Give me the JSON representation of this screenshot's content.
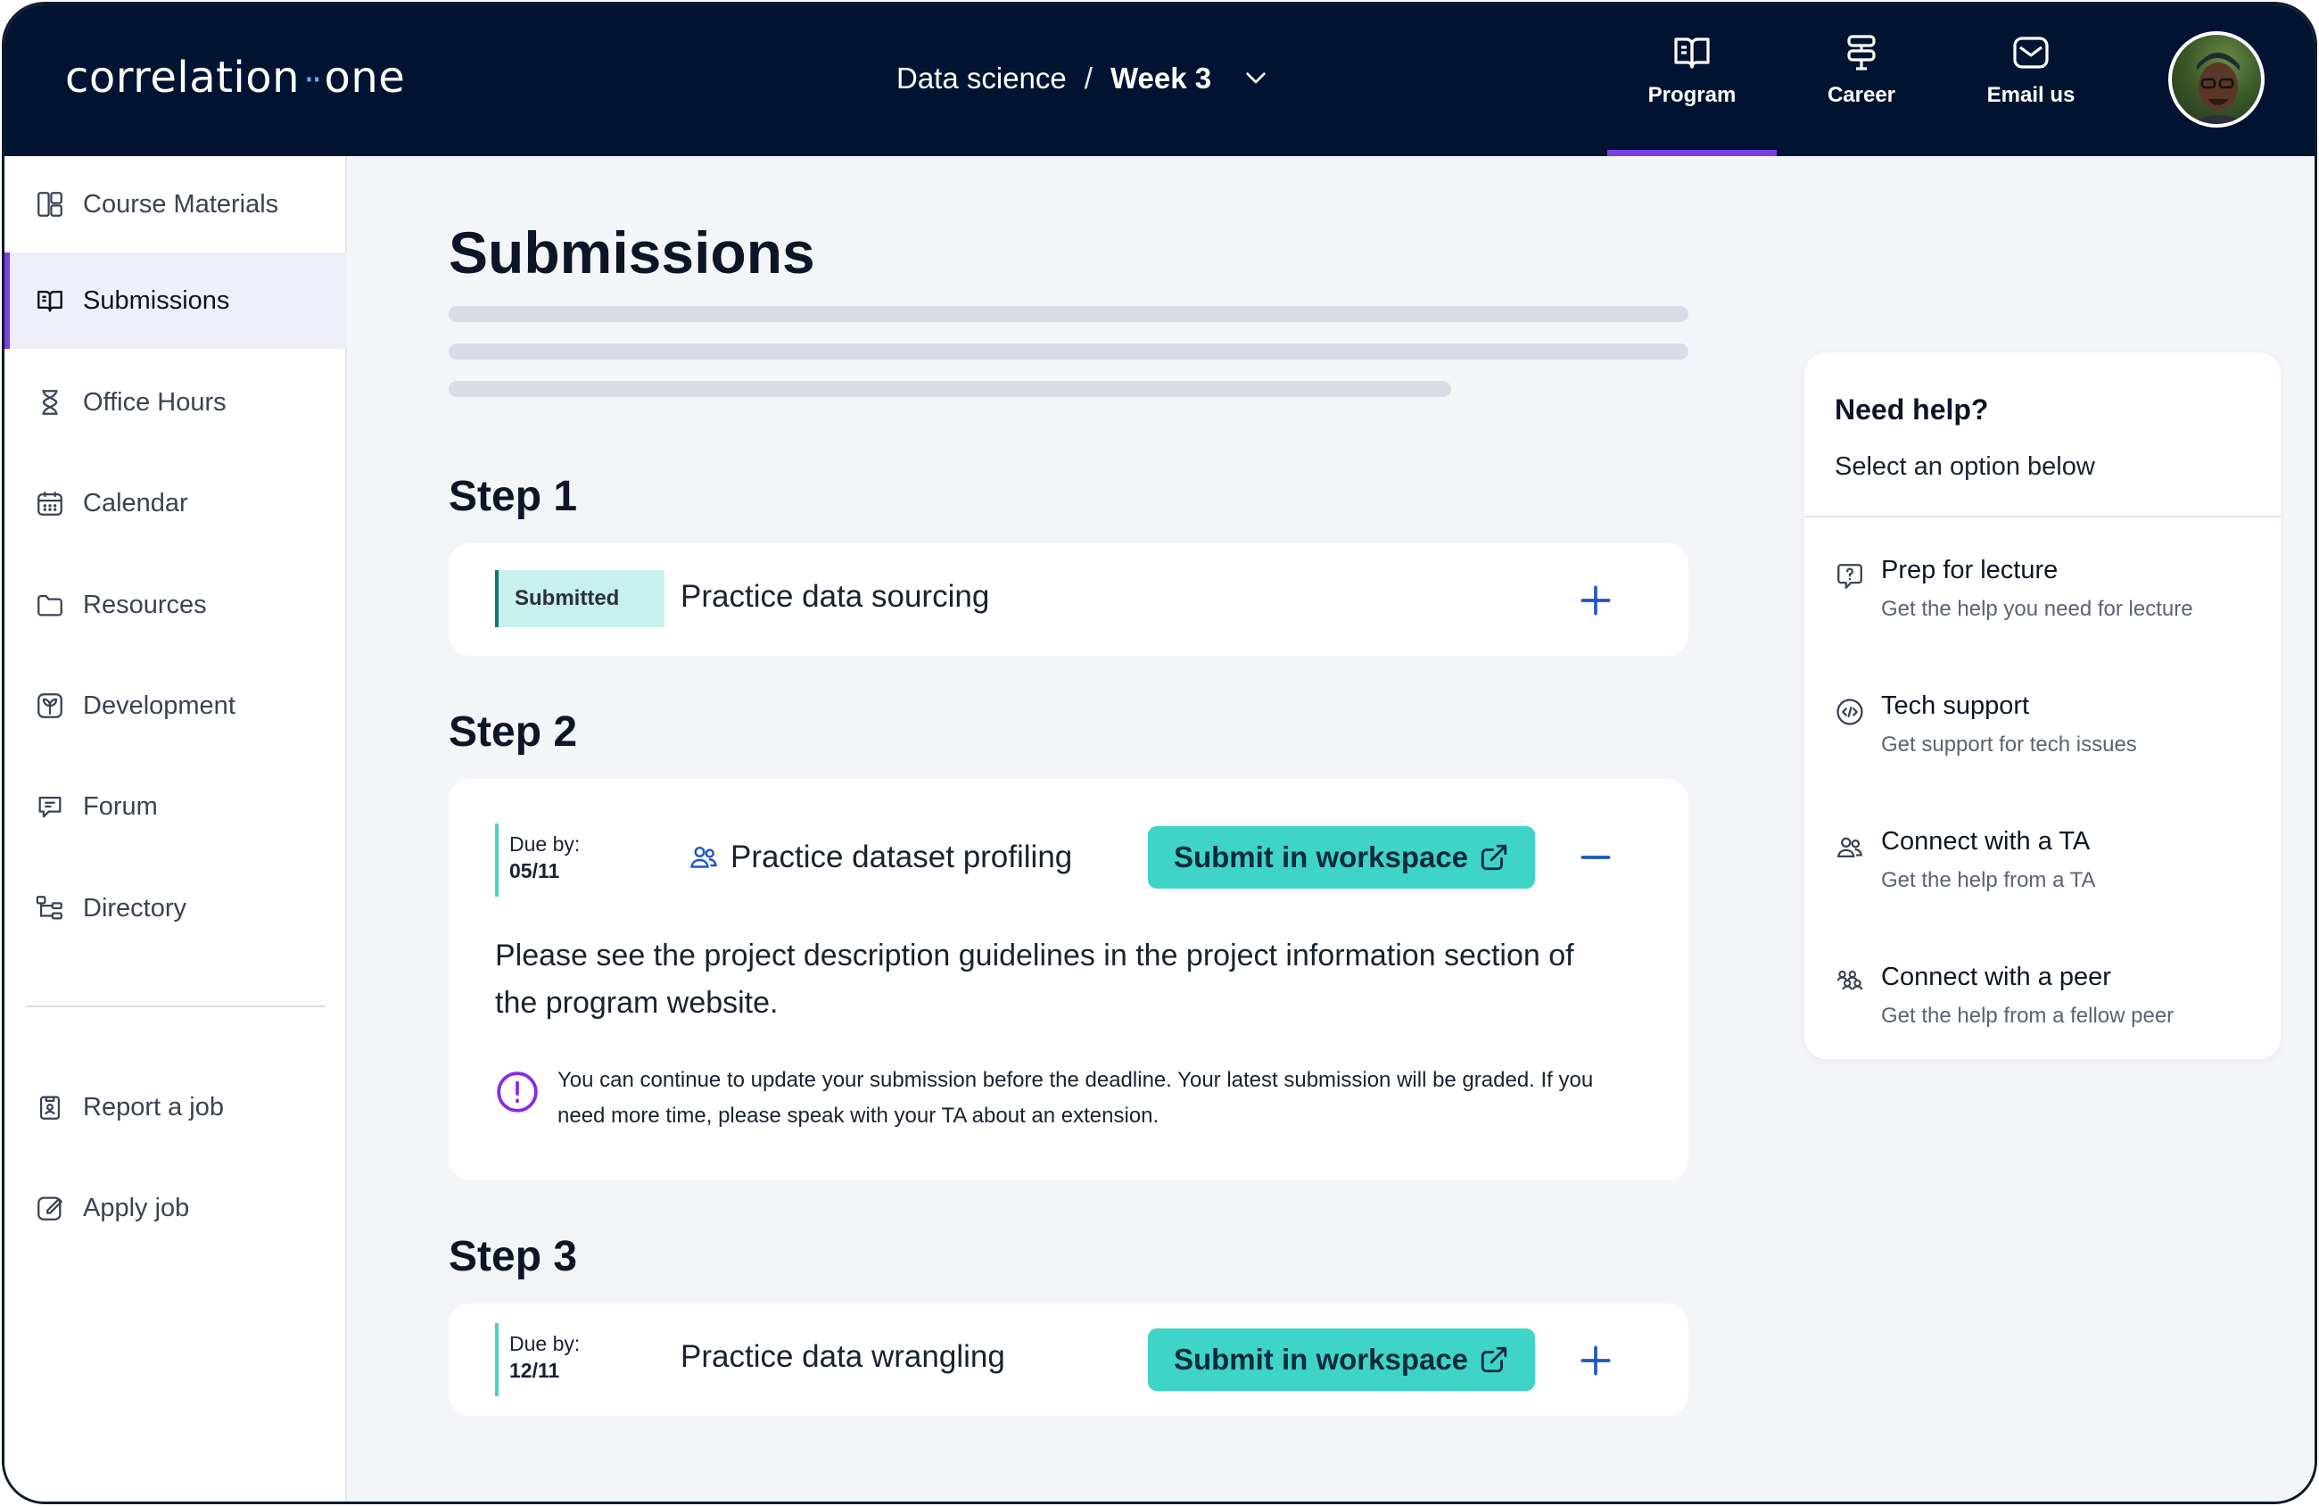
{
  "brand": {
    "logo_left": "correlation",
    "logo_dots": "··",
    "logo_right": "one"
  },
  "header": {
    "breadcrumb_program": "Data science",
    "breadcrumb_sep": "/",
    "breadcrumb_week": "Week 3",
    "nav": [
      {
        "label": "Program",
        "icon": "book-icon",
        "active": true
      },
      {
        "label": "Career",
        "icon": "signpost-icon",
        "active": false
      },
      {
        "label": "Email us",
        "icon": "mail-icon",
        "active": false
      }
    ]
  },
  "sidebar": {
    "items": [
      {
        "label": "Course Materials",
        "icon": "layout-icon"
      },
      {
        "label": "Submissions",
        "icon": "book-open-icon",
        "active": true
      },
      {
        "label": "Office Hours",
        "icon": "hourglass-icon"
      },
      {
        "label": "Calendar",
        "icon": "calendar-icon"
      },
      {
        "label": "Resources",
        "icon": "folder-icon"
      },
      {
        "label": "Development",
        "icon": "growth-icon"
      },
      {
        "label": "Forum",
        "icon": "chat-icon"
      },
      {
        "label": "Directory",
        "icon": "hierarchy-icon"
      }
    ],
    "bottom_items": [
      {
        "label": "Report a job",
        "icon": "clipboard-icon"
      },
      {
        "label": "Apply job",
        "icon": "edit-icon"
      }
    ]
  },
  "main": {
    "title": "Submissions",
    "steps": [
      {
        "heading": "Step 1",
        "status": "Submitted",
        "title": "Practice data sourcing",
        "toggle": "plus"
      },
      {
        "heading": "Step 2",
        "due_label": "Due by:",
        "due_date": "05/11",
        "title": "Practice dataset profiling",
        "button": "Submit in workspace",
        "toggle": "minus",
        "description": "Please see the project description guidelines in the project information section of the program website.",
        "note": "You can continue to update your submission before the deadline. Your latest submission will be graded. If you need more time, please speak with your TA about an extension."
      },
      {
        "heading": "Step 3",
        "due_label": "Due by:",
        "due_date": "12/11",
        "title": "Practice data wrangling",
        "button": "Submit in workspace",
        "toggle": "plus"
      }
    ]
  },
  "help": {
    "title": "Need help?",
    "subtitle": "Select an option below",
    "options": [
      {
        "title": "Prep for lecture",
        "subtitle": "Get the help you need for lecture",
        "icon": "question-bubble-icon"
      },
      {
        "title": "Tech support",
        "subtitle": "Get support for tech issues",
        "icon": "code-icon"
      },
      {
        "title": "Connect with a TA",
        "subtitle": "Get the help from a TA",
        "icon": "users-icon"
      },
      {
        "title": "Connect with a peer",
        "subtitle": "Get the help from a fellow peer",
        "icon": "group-icon"
      }
    ]
  },
  "colors": {
    "navy": "#021431",
    "accent_purple": "#7b3fe4",
    "teal_button": "#3fd4c8",
    "link_blue": "#1f56c4"
  }
}
